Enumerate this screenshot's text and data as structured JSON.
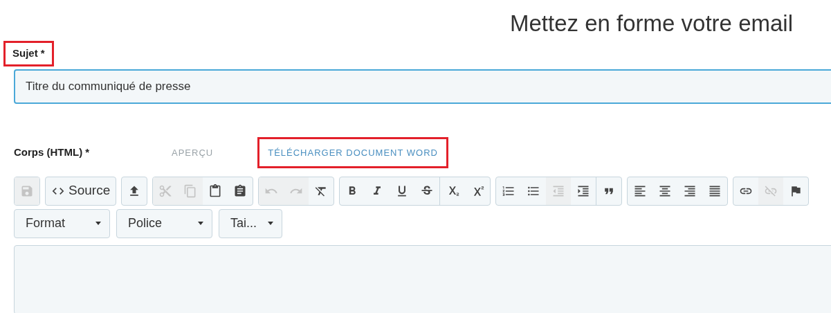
{
  "heading": "Mettez en forme votre email",
  "subject": {
    "label": "Sujet *",
    "highlighted": true,
    "value": "Titre du communiqué de presse"
  },
  "body": {
    "label": "Corps (HTML) *",
    "tabs": [
      {
        "label": "APERÇU",
        "highlighted": false
      },
      {
        "label": "TÉLÉCHARGER DOCUMENT WORD",
        "highlighted": true
      }
    ],
    "toolbar": [
      [
        {
          "kind": "save",
          "disabled": true
        }
      ],
      [
        {
          "kind": "source",
          "label": "Source",
          "disabled": false
        }
      ],
      [
        {
          "kind": "upload",
          "disabled": false
        }
      ],
      [
        {
          "kind": "cut",
          "disabled": true
        },
        {
          "kind": "copy",
          "disabled": true
        },
        {
          "kind": "paste",
          "disabled": false
        },
        {
          "kind": "pastetext",
          "disabled": false
        }
      ],
      [
        {
          "kind": "undo",
          "disabled": true
        },
        {
          "kind": "redo",
          "disabled": true
        },
        {
          "kind": "clearformat",
          "disabled": false
        }
      ],
      [
        {
          "kind": "bold",
          "disabled": false
        },
        {
          "kind": "italic",
          "disabled": false
        },
        {
          "kind": "underline",
          "disabled": false
        },
        {
          "kind": "strike",
          "disabled": false
        },
        {
          "kind": "subscript",
          "disabled": false
        },
        {
          "kind": "superscript",
          "disabled": false
        }
      ],
      [
        {
          "kind": "numbered",
          "disabled": false
        },
        {
          "kind": "bulleted",
          "disabled": false
        },
        {
          "kind": "outdent",
          "disabled": true
        },
        {
          "kind": "indent",
          "disabled": false
        },
        {
          "kind": "quote",
          "disabled": false
        }
      ],
      [
        {
          "kind": "alignleft",
          "disabled": false
        },
        {
          "kind": "aligncenter",
          "disabled": false
        },
        {
          "kind": "alignright",
          "disabled": false
        },
        {
          "kind": "justify",
          "disabled": false
        }
      ],
      [
        {
          "kind": "link",
          "disabled": false
        },
        {
          "kind": "unlink",
          "disabled": true
        },
        {
          "kind": "flag",
          "disabled": false
        }
      ]
    ],
    "dropdowns": [
      {
        "label": "Format"
      },
      {
        "label": "Police"
      },
      {
        "label": "Tai..."
      }
    ]
  }
}
